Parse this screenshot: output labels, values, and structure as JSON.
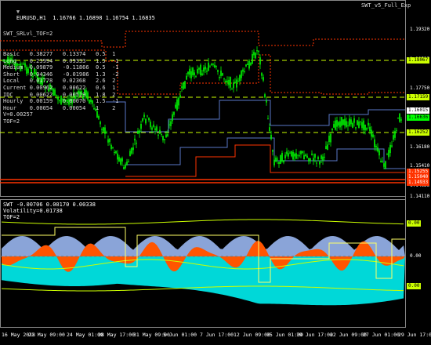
{
  "main_chart": {
    "title": "EURUSD,H1  1.16766 1.16898 1.16754 1.16835",
    "indicator": "SWT_v5_Full_Exp",
    "table_header": "SWT_SRLvl_TOF=2",
    "rows": [
      {
        "label": "Basic",
        "v1": "0.38277",
        "v2": "0.13374",
        "a": "0.5",
        "b": "1"
      },
      {
        "label": "Long",
        "v1": "0.23994",
        "v2": "0.09333",
        "a": "1.5",
        "b": "-1"
      },
      {
        "label": "Medium",
        "v1": "0.09879",
        "v2": "-0.11866",
        "a": "0.5",
        "b": "-1"
      },
      {
        "label": "Short",
        "v1": "0.04346",
        "v2": "-0.01986",
        "a": "1.3",
        "b": "-2"
      },
      {
        "label": "Local",
        "v1": "0.01778",
        "v2": "0.02368",
        "a": "2.6",
        "b": "2"
      },
      {
        "label": "Current",
        "v1": "0.00962",
        "v2": "0.00622",
        "a": "0.6",
        "b": "1"
      },
      {
        "label": "IDC",
        "v1": "0.00622",
        "v2": "0.00519",
        "a": "1.8",
        "b": "2"
      },
      {
        "label": "Hourly",
        "v1": "0.00159",
        "v2": "0.00070",
        "a": "1.5",
        "b": "-1"
      },
      {
        "label": "Hour",
        "v1": "0.00054",
        "v2": "0.00054",
        "a": "1",
        "b": "2"
      }
    ],
    "v_text": "V=0.00257",
    "tof_text": "TOF=2",
    "price_ticks": [
      "1.19320",
      "1.18535",
      "1.17750",
      "1.16965",
      "1.16180",
      "1.15410",
      "1.14625",
      "1.14110"
    ],
    "price_tags": [
      {
        "text": "1.18067",
        "color": "#ccff00",
        "fg": "#000"
      },
      {
        "text": "1.17159",
        "color": "#ccff00",
        "fg": "#000"
      },
      {
        "text": "1.16835",
        "color": "#ffffff",
        "fg": "#000"
      },
      {
        "text": "1.16636",
        "color": "#00ff00",
        "fg": "#000"
      },
      {
        "text": "1.16015",
        "color": "#ffffff",
        "fg": "#000"
      },
      {
        "text": "1.16252",
        "color": "#ccff00",
        "fg": "#000"
      },
      {
        "text": "1.15255",
        "color": "#ff3300",
        "fg": "#fff"
      },
      {
        "text": "1.15040",
        "color": "#ff3300",
        "fg": "#fff"
      },
      {
        "text": "1.14933",
        "color": "#ff3300",
        "fg": "#fff"
      }
    ]
  },
  "sub_chart": {
    "title": "SWT -0.00706 0.00170 0.00338",
    "volatility": "Volatility=0.01738",
    "tof": "TOF=2",
    "zero_tick": "0.00",
    "top_value": "0.00",
    "bottom_value": "0.00"
  },
  "time_axis": [
    "16 May 2018",
    "21 May 09:00",
    "24 May 01:00",
    "28 May 17:00",
    "31 May 09:00",
    "5 Jun 01:00",
    "7 Jun 17:00",
    "12 Jun 09:00",
    "15 Jun 01:00",
    "19 Jun 17:00",
    "22 Jun 09:00",
    "27 Jun 01:00",
    "29 Jun 17:00"
  ],
  "colors": {
    "candles": "#00ff00",
    "support": "#ff3300",
    "resistance": "#ff3300",
    "blue_levels": "#5a78c8",
    "yellow_lines": "#ccff00",
    "osc_orange": "#ff5500",
    "osc_blue": "#8aa4d8",
    "osc_cyan": "#00d8d8",
    "axis": "#888888"
  }
}
